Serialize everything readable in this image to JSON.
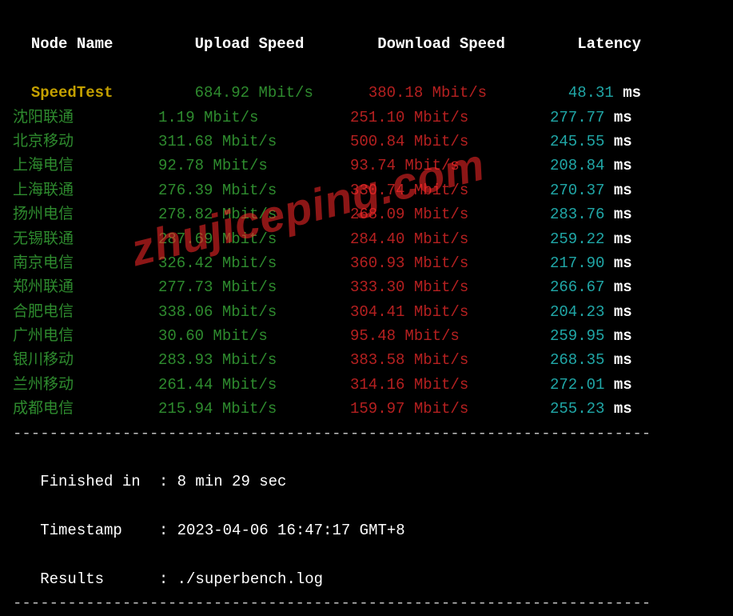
{
  "headers": {
    "node": "Node Name",
    "upload": "Upload Speed",
    "download": "Download Speed",
    "latency": "Latency"
  },
  "speedtest_row": {
    "node": "SpeedTest",
    "upload": "684.92 Mbit/s",
    "download": "380.18 Mbit/s",
    "latency_val": "48.31",
    "latency_unit": "ms"
  },
  "rows": [
    {
      "node": "沈阳联通",
      "upload": "1.19 Mbit/s",
      "download": "251.10 Mbit/s",
      "latency_val": "277.77",
      "latency_unit": "ms"
    },
    {
      "node": "北京移动",
      "upload": "311.68 Mbit/s",
      "download": "500.84 Mbit/s",
      "latency_val": "245.55",
      "latency_unit": "ms"
    },
    {
      "node": "上海电信",
      "upload": "92.78 Mbit/s",
      "download": "93.74 Mbit/s",
      "latency_val": "208.84",
      "latency_unit": "ms"
    },
    {
      "node": "上海联通",
      "upload": "276.39 Mbit/s",
      "download": "330.74 Mbit/s",
      "latency_val": "270.37",
      "latency_unit": "ms"
    },
    {
      "node": "扬州电信",
      "upload": "278.82 Mbit/s",
      "download": "268.09 Mbit/s",
      "latency_val": "283.76",
      "latency_unit": "ms"
    },
    {
      "node": "无锡联通",
      "upload": "287.69 Mbit/s",
      "download": "284.40 Mbit/s",
      "latency_val": "259.22",
      "latency_unit": "ms"
    },
    {
      "node": "南京电信",
      "upload": "326.42 Mbit/s",
      "download": "360.93 Mbit/s",
      "latency_val": "217.90",
      "latency_unit": "ms"
    },
    {
      "node": "郑州联通",
      "upload": "277.73 Mbit/s",
      "download": "333.30 Mbit/s",
      "latency_val": "266.67",
      "latency_unit": "ms"
    },
    {
      "node": "合肥电信",
      "upload": "338.06 Mbit/s",
      "download": "304.41 Mbit/s",
      "latency_val": "204.23",
      "latency_unit": "ms"
    },
    {
      "node": "广州电信",
      "upload": "30.60 Mbit/s",
      "download": "95.48 Mbit/s",
      "latency_val": "259.95",
      "latency_unit": "ms"
    },
    {
      "node": "银川移动",
      "upload": "283.93 Mbit/s",
      "download": "383.58 Mbit/s",
      "latency_val": "268.35",
      "latency_unit": "ms"
    },
    {
      "node": "兰州移动",
      "upload": "261.44 Mbit/s",
      "download": "314.16 Mbit/s",
      "latency_val": "272.01",
      "latency_unit": "ms"
    },
    {
      "node": "成都电信",
      "upload": "215.94 Mbit/s",
      "download": "159.97 Mbit/s",
      "latency_val": "255.23",
      "latency_unit": "ms"
    }
  ],
  "footer": {
    "finished_label": "Finished in",
    "finished_value": "8 min 29 sec",
    "timestamp_label": "Timestamp",
    "timestamp_value": "2023-04-06 16:47:17 GMT+8",
    "results_label": "Results",
    "results_value": "./superbench.log"
  },
  "watermark": "zhujiceping.com",
  "divider": "----------------------------------------------------------------------"
}
